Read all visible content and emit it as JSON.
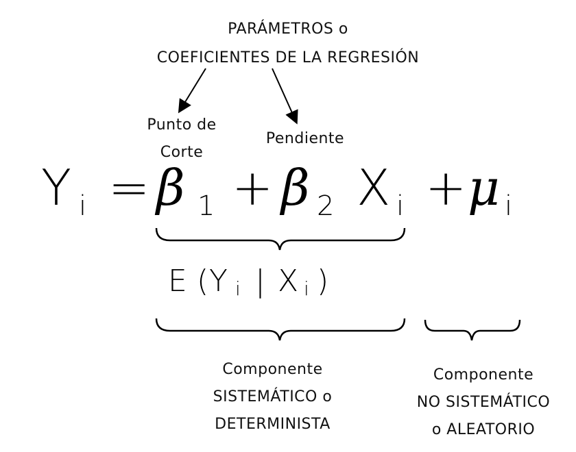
{
  "header": {
    "line1": "PARÁMETROS o",
    "line2": "COEFICIENTES DE LA REGRESIÓN"
  },
  "labels": {
    "punto_line1": "Punto de",
    "punto_line2": "Corte",
    "pendiente": "Pendiente"
  },
  "equation": {
    "Y": "Y",
    "Y_sub": "i",
    "equals": "=",
    "beta1": "β",
    "beta1_sub": "1",
    "plus1": "+",
    "beta2": "β",
    "beta2_sub": "2",
    "X": "X",
    "X_sub": "i",
    "plus2": "+",
    "mu": "μ",
    "mu_sub": "i"
  },
  "expectation": {
    "E": "E",
    "open_paren": "(",
    "Y": "Y",
    "Y_sub": "i",
    "bar": "|",
    "X": "X",
    "X_sub": "i",
    "close_paren": ")"
  },
  "components": {
    "systematic": [
      "Componente",
      "SISTEMÁTICO o",
      "DETERMINISTA"
    ],
    "non_systematic": [
      "Componente",
      "NO SISTEMÁTICO",
      "o ALEATORIO"
    ]
  }
}
